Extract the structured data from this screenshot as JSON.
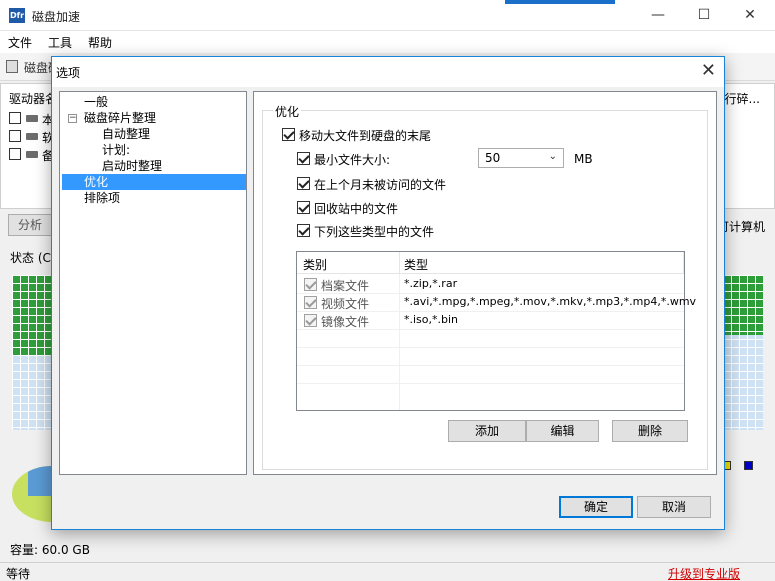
{
  "app": {
    "icon_text": "Dfr",
    "title": "磁盘加速",
    "menu": [
      "文件",
      "工具",
      "帮助"
    ],
    "toolbar_label": "磁盘碎",
    "drive_header": "驱动器名",
    "drive_header_right": "行碎...",
    "drives": [
      "本",
      "软",
      "备"
    ],
    "analyze_label": "分析",
    "right_button_text": "可计算机",
    "status_label": "状态 (C:",
    "capacity": "容量: 60.0 GB",
    "status_text": "等待",
    "upgrade_link": "升级到专业版",
    "legend_colors": [
      "#f0e000",
      "#0000cc"
    ]
  },
  "dialog": {
    "title": "选项",
    "tree": [
      {
        "label": "一般"
      },
      {
        "label": "磁盘碎片整理",
        "expander": "−"
      },
      {
        "label": "自动整理"
      },
      {
        "label": "计划:"
      },
      {
        "label": "启动时整理"
      },
      {
        "label": "优化",
        "selected": true
      },
      {
        "label": "排除项"
      }
    ],
    "group_title": "优化",
    "options": {
      "move_large": "移动大文件到硬盘的末尾",
      "min_size": "最小文件大小:",
      "min_size_value": "50",
      "min_size_unit": "MB",
      "not_accessed": "在上个月未被访问的文件",
      "recycle_bin": "回收站中的文件",
      "file_types": "下列这些类型中的文件"
    },
    "list": {
      "columns": [
        "类别",
        "类型"
      ],
      "rows": [
        {
          "category": "档案文件",
          "types": "*.zip,*.rar"
        },
        {
          "category": "视频文件",
          "types": "*.avi,*.mpg,*.mpeg,*.mov,*.mkv,*.mp3,*.mp4,*.wmv"
        },
        {
          "category": "镜像文件",
          "types": "*.iso,*.bin"
        }
      ]
    },
    "buttons": {
      "add": "添加",
      "edit": "编辑",
      "delete": "删除",
      "ok": "确定",
      "cancel": "取消"
    }
  }
}
